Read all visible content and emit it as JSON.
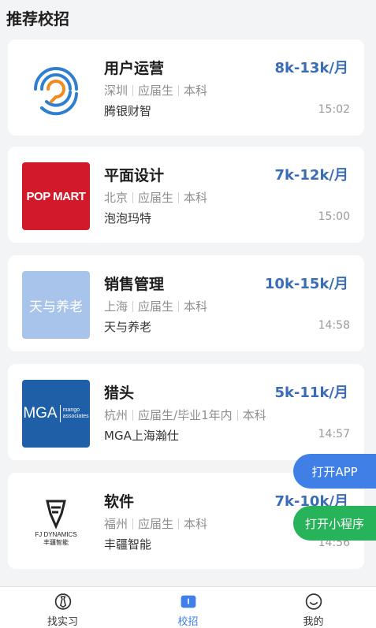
{
  "header": {
    "title": "推荐校招"
  },
  "jobs": [
    {
      "title": "用户运营",
      "salary": "8k-13k/月",
      "city": "深圳",
      "degree_req": "应届生",
      "education": "本科",
      "company": "腾银财智",
      "time": "15:02",
      "logo": "tengyin-logo"
    },
    {
      "title": "平面设计",
      "salary": "7k-12k/月",
      "city": "北京",
      "degree_req": "应届生",
      "education": "本科",
      "company": "泡泡玛特",
      "time": "15:00",
      "logo": "popmart-logo",
      "logo_text": "POP MART"
    },
    {
      "title": "销售管理",
      "salary": "10k-15k/月",
      "city": "上海",
      "degree_req": "应届生",
      "education": "本科",
      "company": "天与养老",
      "time": "14:58",
      "logo": "tianyu-logo",
      "logo_text": "天与养老"
    },
    {
      "title": "猎头",
      "salary": "5k-11k/月",
      "city": "杭州",
      "degree_req": "应届生/毕业1年内",
      "education": "本科",
      "company": "MGA上海瀚仕",
      "time": "14:57",
      "logo": "mga-logo",
      "logo_text": "MGA",
      "logo_sub1": "mango",
      "logo_sub2": "associates"
    },
    {
      "title": "软件",
      "salary": "7k-10k/月",
      "city": "福州",
      "degree_req": "应届生",
      "education": "本科",
      "company": "丰疆智能",
      "time": "14:56",
      "logo": "fj-dynamics-logo",
      "logo_text": "FJ DYNAMICS",
      "logo_sub": "丰疆智能"
    }
  ],
  "floating": {
    "open_app": "打开APP",
    "open_mini": "打开小程序"
  },
  "tabs": [
    {
      "label": "找实习",
      "icon": "tie-icon"
    },
    {
      "label": "校招",
      "icon": "book-icon"
    },
    {
      "label": "我的",
      "icon": "face-icon"
    }
  ],
  "colors": {
    "accent": "#3f7fe6",
    "salary": "#3a6db5",
    "mini": "#27b35a"
  }
}
